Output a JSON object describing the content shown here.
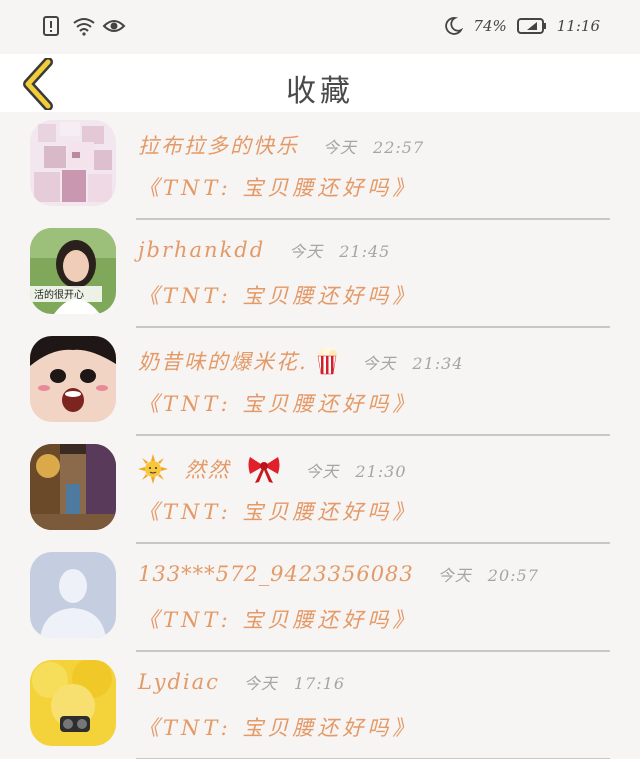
{
  "status_bar": {
    "battery": "74%",
    "time": "11:16"
  },
  "header": {
    "title": "收藏"
  },
  "colors": {
    "accent": "#e39a67",
    "back_arrow": "#f2cd3a",
    "muted": "#a5a5a5"
  },
  "items": [
    {
      "name": "拉布拉多的快乐",
      "day": "今天",
      "time": "22:57",
      "title": "《TNT: 宝贝腰还好吗》",
      "avatar_icon": "pixelated-anime-avatar"
    },
    {
      "name": "jbrhankdd",
      "day": "今天",
      "time": "21:45",
      "title": "《TNT: 宝贝腰还好吗》",
      "avatar_icon": "girl-photo-avatar",
      "avatar_caption": "活的很开心"
    },
    {
      "name": "奶昔味的爆米花.",
      "day": "今天",
      "time": "21:34",
      "title": "《TNT: 宝贝腰还好吗》",
      "avatar_icon": "surprised-face-avatar",
      "name_emoji": "popcorn-icon"
    },
    {
      "name": "然然",
      "day": "今天",
      "time": "21:30",
      "title": "《TNT: 宝贝腰还好吗》",
      "avatar_icon": "ornate-room-avatar",
      "name_emoji_before": "sun-icon",
      "name_emoji_after": "ribbon-icon"
    },
    {
      "name": "133***572_9423356083",
      "day": "今天",
      "time": "20:57",
      "title": "《TNT: 宝贝腰还好吗》",
      "avatar_icon": "default-person-avatar"
    },
    {
      "name": "Lydiac",
      "day": "今天",
      "time": "17:16",
      "title": "《TNT: 宝贝腰还好吗》",
      "avatar_icon": "yellow-fluffy-avatar"
    }
  ]
}
